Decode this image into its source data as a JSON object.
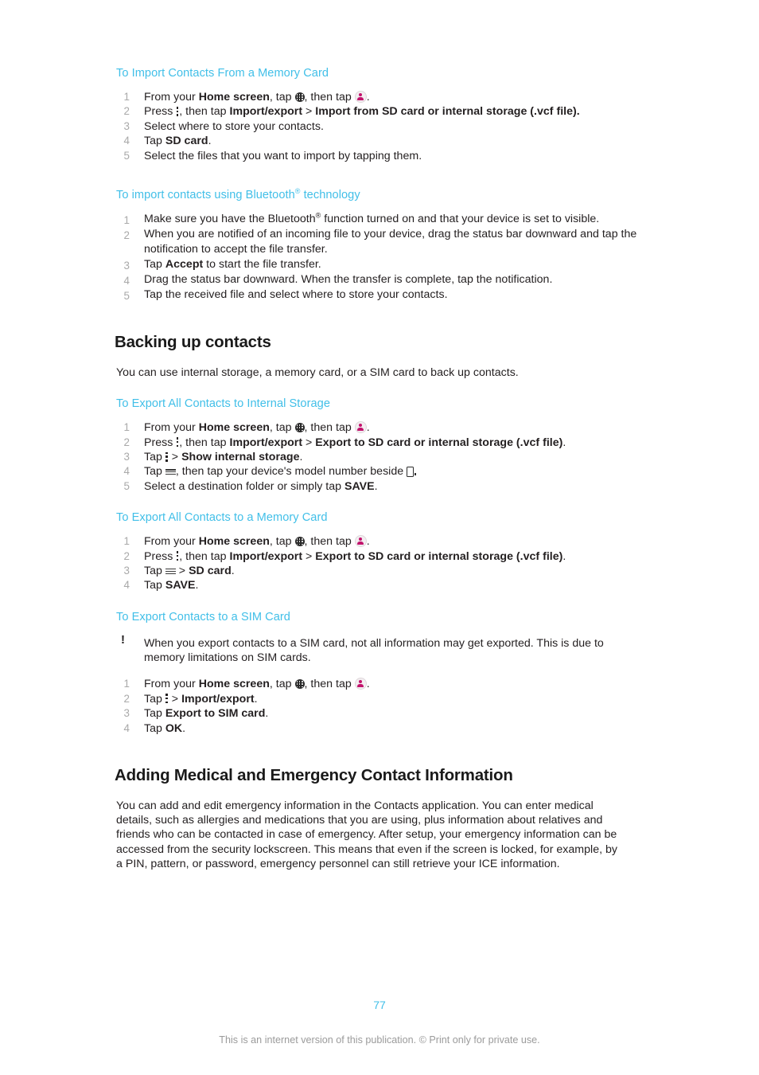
{
  "document": {
    "page_number": "77",
    "footer_note": "This is an internet version of this publication. © Print only for private use.",
    "heading_color": "#41bfe8",
    "body_color": "#231f20",
    "step_number_color": "#a9a9a9",
    "icon_accent_color": "#c2136c"
  },
  "sections": {
    "import_memory_card": {
      "title": "To Import Contacts From a Memory Card",
      "steps": {
        "s1": {
          "pre": "From your ",
          "b1": "Home screen",
          "mid": ", tap ",
          "icon1": "app-drawer-icon",
          "mid2": ", then tap ",
          "icon2": "contacts-icon",
          "post": "."
        },
        "s2": {
          "pre": "Press ",
          "icon": "overflow-menu-icon",
          "mid": ", then tap ",
          "b1": "Import/export",
          "sep": " > ",
          "b2": "Import from SD card or internal storage (.vcf file)",
          "post": "."
        },
        "s3": {
          "text": "Select where to store your contacts."
        },
        "s4": {
          "pre": "Tap ",
          "b1": "SD card",
          "post": "."
        },
        "s5": {
          "text": "Select the files that you want to import by tapping them."
        }
      }
    },
    "import_bluetooth": {
      "title_pre": "To import contacts using Bluetooth",
      "title_sup": "®",
      "title_post": " technology",
      "steps": {
        "s1": {
          "pre": "Make sure you have the Bluetooth",
          "sup": "®",
          "post": " function turned on and that your device is set to visible."
        },
        "s2": {
          "text": "When you are notified of an incoming file to your device, drag the status bar downward and tap the notification to accept the file transfer."
        },
        "s3": {
          "pre": "Tap ",
          "b1": "Accept",
          "post": " to start the file transfer."
        },
        "s4": {
          "text": "Drag the status bar downward. When the transfer is complete, tap the notification."
        },
        "s5": {
          "text": "Tap the received file and select where to store your contacts."
        }
      }
    },
    "backing_up": {
      "heading": "Backing up contacts",
      "intro": "You can use internal storage, a memory card, or a SIM card to back up contacts."
    },
    "export_internal": {
      "title": "To Export All Contacts to Internal Storage",
      "steps": {
        "s1": {
          "pre": "From your ",
          "b1": "Home screen",
          "mid": ", tap ",
          "icon1": "app-drawer-icon",
          "mid2": ", then tap ",
          "icon2": "contacts-icon",
          "post": "."
        },
        "s2": {
          "pre": "Press ",
          "icon": "overflow-menu-icon",
          "mid": ", then tap ",
          "b1": "Import/export",
          "sep": " > ",
          "b2": "Export to SD card or internal storage (.vcf file)",
          "post": "."
        },
        "s3": {
          "pre": "Tap ",
          "icon": "overflow-menu-icon",
          "sep": " > ",
          "b1": "Show internal storage",
          "post": "."
        },
        "s4": {
          "pre": "Tap ",
          "icon1": "hamburger-menu-icon",
          "mid": ", then tap your device's model number beside ",
          "icon2": "device-icon",
          "post": "."
        },
        "s5": {
          "pre": "Select a destination folder or simply tap ",
          "b1": "SAVE",
          "post": "."
        }
      }
    },
    "export_memory_card": {
      "title": "To Export All Contacts to a Memory Card",
      "steps": {
        "s1": {
          "pre": "From your ",
          "b1": "Home screen",
          "mid": ", tap ",
          "icon1": "app-drawer-icon",
          "mid2": ", then tap ",
          "icon2": "contacts-icon",
          "post": "."
        },
        "s2": {
          "pre": "Press ",
          "icon": "overflow-menu-icon",
          "mid": ", then tap ",
          "b1": "Import/export",
          "sep": " > ",
          "b2": "Export to SD card or internal storage (.vcf file)",
          "post": "."
        },
        "s3": {
          "pre": "Tap ",
          "icon": "hamburger-menu-icon",
          "sep": " > ",
          "b1": "SD card",
          "post": "."
        },
        "s4": {
          "pre": "Tap ",
          "b1": "SAVE",
          "post": "."
        }
      }
    },
    "export_sim": {
      "title": "To Export Contacts to a SIM Card",
      "note_marker": "!",
      "note": "When you export contacts to a SIM card, not all information may get exported. This is due to memory limitations on SIM cards.",
      "steps": {
        "s1": {
          "pre": "From your ",
          "b1": "Home screen",
          "mid": ", tap ",
          "icon1": "app-drawer-icon",
          "mid2": ", then tap ",
          "icon2": "contacts-icon",
          "post": "."
        },
        "s2": {
          "pre": "Tap ",
          "icon": "overflow-menu-icon",
          "sep": " > ",
          "b1": "Import/export",
          "post": "."
        },
        "s3": {
          "pre": "Tap ",
          "b1": "Export to SIM card",
          "post": "."
        },
        "s4": {
          "pre": "Tap ",
          "b1": "OK",
          "post": "."
        }
      }
    },
    "medical": {
      "heading": "Adding Medical and Emergency Contact Information",
      "body": "You can add and edit emergency information in the Contacts application. You can enter medical details, such as allergies and medications that you are using, plus information about relatives and friends who can be contacted in case of emergency. After setup, your emergency information can be accessed from the security lockscreen. This means that even if the screen is locked, for example, by a PIN, pattern, or password, emergency personnel can still retrieve your ICE information."
    }
  }
}
